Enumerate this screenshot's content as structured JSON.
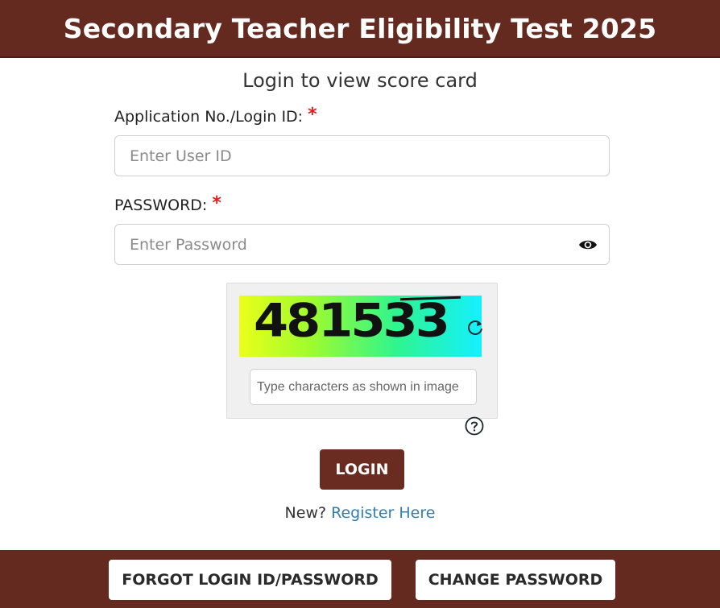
{
  "header": {
    "title": "Secondary Teacher Eligibility Test 2025"
  },
  "subtitle": "Login to view score card",
  "form": {
    "user_label": "Application No./Login ID:",
    "user_placeholder": "Enter User ID",
    "user_value": "",
    "password_label": "PASSWORD:",
    "password_placeholder": "Enter Password",
    "password_value": "",
    "required_mark": "*"
  },
  "captcha": {
    "image_text": "481533",
    "input_placeholder": "Type characters as shown in image",
    "input_value": ""
  },
  "login_label": "LOGIN",
  "register": {
    "prefix": "New?",
    "link_text": "Register Here"
  },
  "footer": {
    "forgot_label": "FORGOT LOGIN ID/PASSWORD",
    "change_label": "CHANGE PASSWORD"
  },
  "colors": {
    "brand": "#642a20",
    "link": "#2f7fb0",
    "required": "#e02020"
  },
  "icons": {
    "eye": "eye-icon",
    "refresh": "refresh-icon",
    "help": "help-circle-icon"
  }
}
